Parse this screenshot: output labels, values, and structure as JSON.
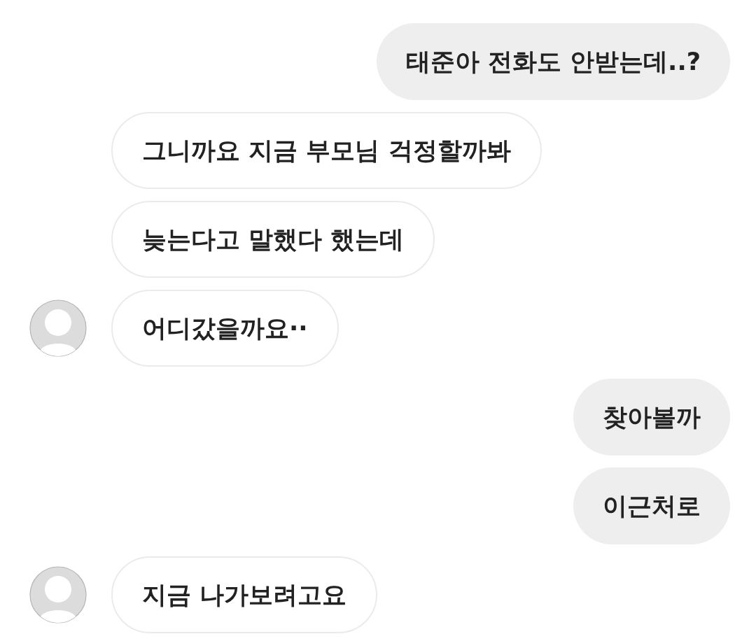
{
  "messages": [
    {
      "kind": "sent",
      "text": "태준아 전화도 안받는데..?"
    },
    {
      "kind": "received",
      "avatar": false,
      "text": "그니까요 지금 부모님 걱정할까봐"
    },
    {
      "kind": "received",
      "avatar": false,
      "text": "늦는다고 말했다 했는데"
    },
    {
      "kind": "received",
      "avatar": true,
      "text": "어디갔을까요··"
    },
    {
      "kind": "sent",
      "text": "찾아볼까"
    },
    {
      "kind": "sent",
      "text": "이근처로"
    },
    {
      "kind": "received",
      "avatar": true,
      "text": "지금 나가보려고요"
    }
  ]
}
